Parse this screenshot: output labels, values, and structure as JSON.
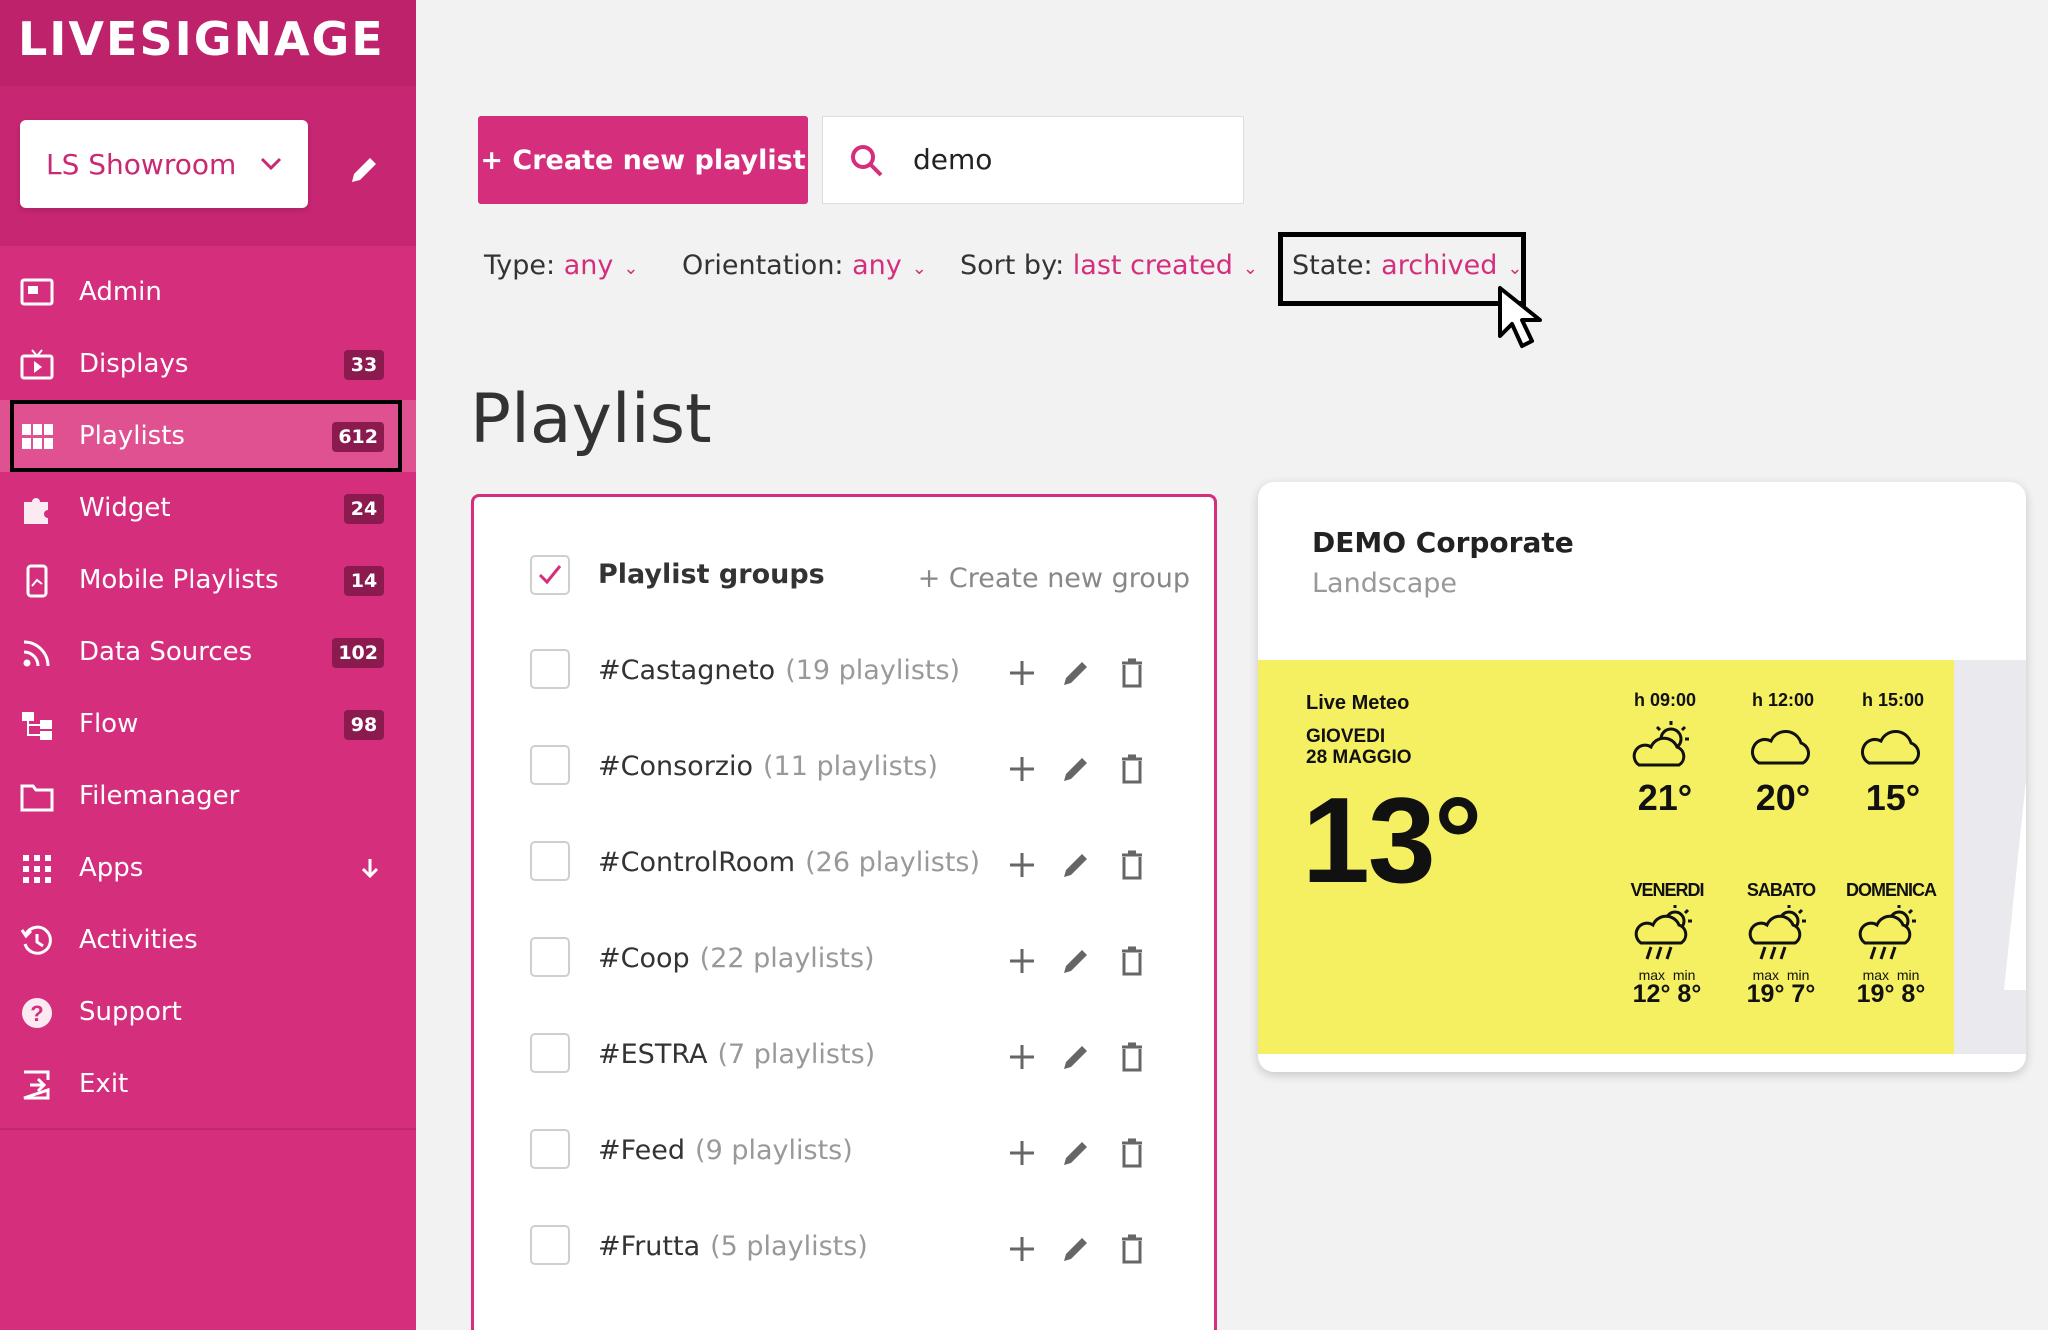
{
  "brand": {
    "logo": "LIVESIGNAGE"
  },
  "account": {
    "name": "LS Showroom"
  },
  "nav": [
    {
      "label": "Admin",
      "badge": null,
      "icon": "admin-icon"
    },
    {
      "label": "Displays",
      "badge": "33",
      "icon": "display-icon"
    },
    {
      "label": "Playlists",
      "badge": "612",
      "icon": "grid-icon",
      "active": true
    },
    {
      "label": "Widget",
      "badge": "24",
      "icon": "puzzle-icon"
    },
    {
      "label": "Mobile Playlists",
      "badge": "14",
      "icon": "mobile-icon"
    },
    {
      "label": "Data Sources",
      "badge": "102",
      "icon": "rss-icon"
    },
    {
      "label": "Flow",
      "badge": "98",
      "icon": "flow-icon"
    },
    {
      "label": "Filemanager",
      "badge": null,
      "icon": "folder-icon"
    },
    {
      "label": "Apps",
      "badge": null,
      "icon": "apps-icon"
    },
    {
      "label": "Activities",
      "badge": null,
      "icon": "history-icon"
    },
    {
      "label": "Support",
      "badge": null,
      "icon": "help-icon"
    },
    {
      "label": "Exit",
      "badge": null,
      "icon": "exit-icon"
    }
  ],
  "toolbar": {
    "create_label": "+ Create new playlist",
    "search_value": "demo"
  },
  "filters": {
    "type": {
      "label": "Type:",
      "value": "any"
    },
    "orientation": {
      "label": "Orientation:",
      "value": "any"
    },
    "sort": {
      "label": "Sort by:",
      "value": "last created"
    },
    "state": {
      "label": "State:",
      "value": "archived"
    }
  },
  "page": {
    "title": "Playlist"
  },
  "groups": {
    "title": "Playlist groups",
    "create_label": "+ Create new group",
    "items": [
      {
        "name": "#Castagneto",
        "count": "(19 playlists)"
      },
      {
        "name": "#Consorzio",
        "count": "(11 playlists)"
      },
      {
        "name": "#ControlRoom",
        "count": "(26 playlists)"
      },
      {
        "name": "#Coop",
        "count": "(22 playlists)"
      },
      {
        "name": "#ESTRA",
        "count": "(7 playlists)"
      },
      {
        "name": "#Feed",
        "count": "(9 playlists)"
      },
      {
        "name": "#Frutta",
        "count": "(5 playlists)"
      }
    ]
  },
  "card": {
    "title": "DEMO Corporate",
    "subtitle": "Landscape",
    "preview": {
      "widget_title": "Live Meteo",
      "day": "GIOVEDI",
      "date": "28 MAGGIO",
      "current_temp": "13°",
      "hours": [
        {
          "time": "h 09:00",
          "temp": "21°"
        },
        {
          "time": "h 12:00",
          "temp": "20°"
        },
        {
          "time": "h 15:00",
          "temp": "15°"
        }
      ],
      "days": [
        {
          "day": "VENERDI",
          "max_label": "max",
          "min_label": "min",
          "max": "12°",
          "min": "8°"
        },
        {
          "day": "SABATO",
          "max_label": "max",
          "min_label": "min",
          "max": "19°",
          "min": "7°"
        },
        {
          "day": "DOMENICA",
          "max_label": "max",
          "min_label": "min",
          "max": "19°",
          "min": "8°"
        }
      ]
    }
  }
}
